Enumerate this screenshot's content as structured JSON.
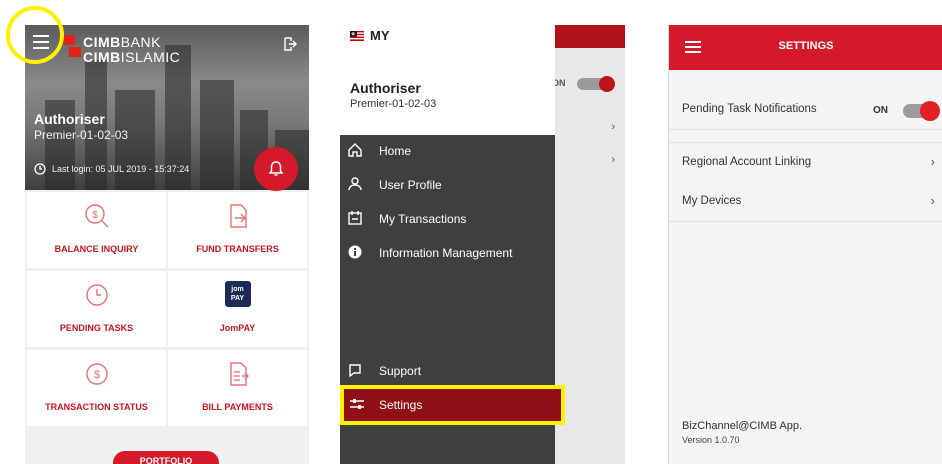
{
  "dashboard": {
    "brand_line1_bold": "CIMB",
    "brand_line1_rest": "BANK",
    "brand_line2_bold": "CIMB",
    "brand_line2_rest": "ISLAMIC",
    "role": "Authoriser",
    "code": "Premier-01-02-03",
    "last_login": "Last login: 05 JUL 2019 - 15:37:24",
    "tiles": [
      {
        "label": "BALANCE INQUIRY",
        "icon": "balance-inquiry-icon"
      },
      {
        "label": "FUND TRANSFERS",
        "icon": "fund-transfer-icon"
      },
      {
        "label": "PENDING TASKS",
        "icon": "pending-tasks-icon"
      },
      {
        "label": "JomPAY",
        "icon": "jompay-icon"
      },
      {
        "label": "TRANSACTION STATUS",
        "icon": "transaction-status-icon"
      },
      {
        "label": "BILL PAYMENTS",
        "icon": "bill-payments-icon"
      }
    ],
    "portfolio": "PORTFOLIO",
    "jompay_logo_text": "jom PAY"
  },
  "drawer": {
    "country": "MY",
    "role": "Authoriser",
    "code": "Premier-01-02-03",
    "behind_toggle": "ON",
    "items": [
      {
        "label": "Home",
        "icon": "home-icon"
      },
      {
        "label": "User Profile",
        "icon": "user-icon"
      },
      {
        "label": "My Transactions",
        "icon": "transactions-icon"
      },
      {
        "label": "Information Management",
        "icon": "info-icon"
      }
    ],
    "support": "Support",
    "settings": "Settings"
  },
  "settings": {
    "title": "SETTINGS",
    "rows": [
      {
        "label": "Pending Task Notifications"
      },
      {
        "label": "Regional Account Linking"
      },
      {
        "label": "My Devices"
      }
    ],
    "toggle_state": "ON",
    "app_name": "BizChannel@CIMB App.",
    "version": "Version 1.0.70"
  },
  "colors": {
    "brand_red": "#d3192a",
    "highlight_yellow": "#fff200",
    "drawer_dark": "#3f3f3f"
  }
}
